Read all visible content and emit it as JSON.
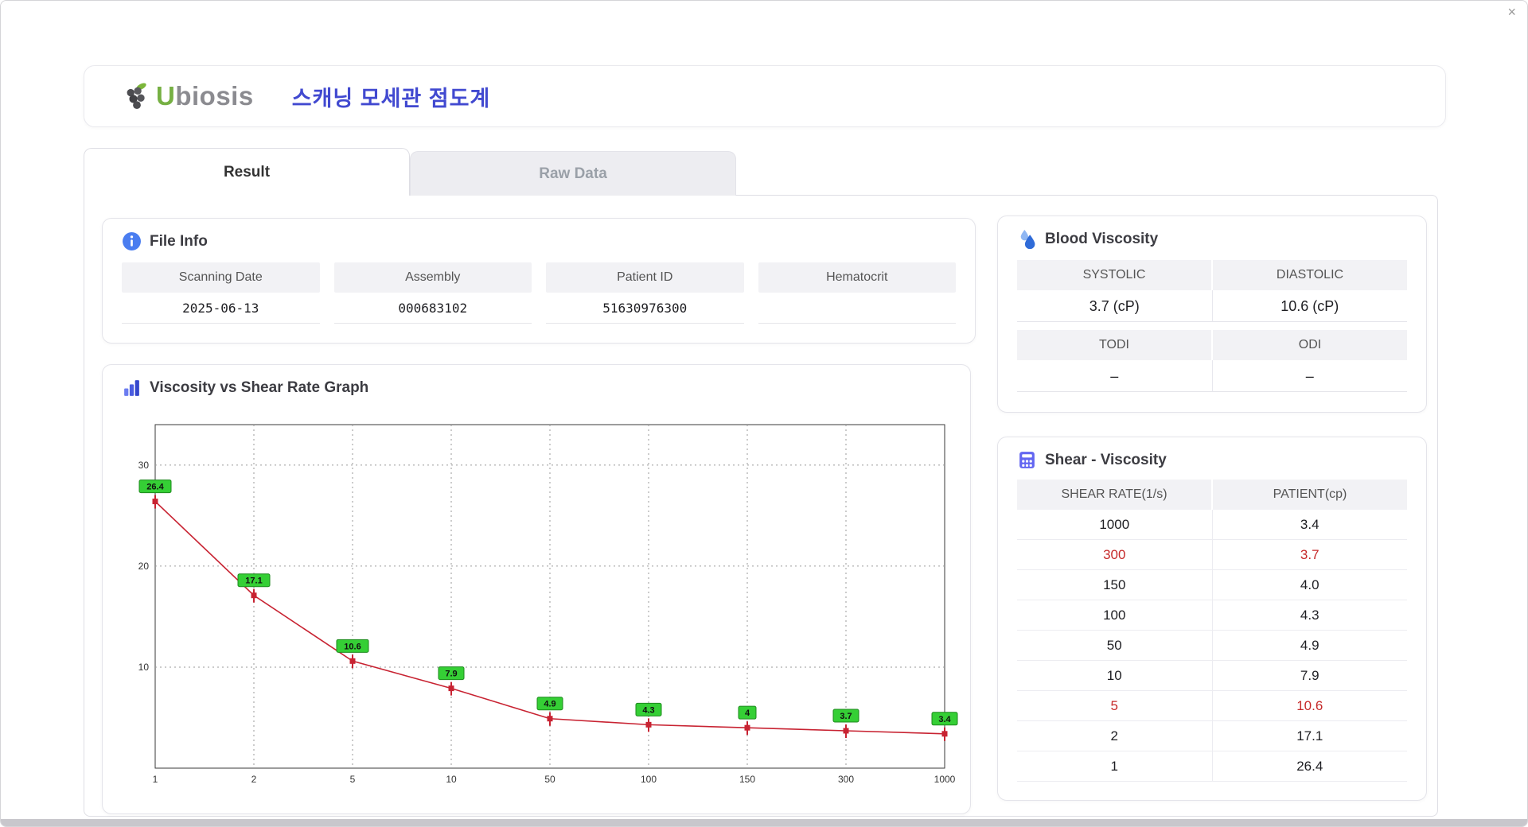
{
  "window": {
    "close_glyph": "×"
  },
  "header": {
    "logo": {
      "u": "U",
      "rest": "biosis"
    },
    "title": "스캐닝 모세관 점도계"
  },
  "tabs": [
    {
      "label": "Result",
      "active": true
    },
    {
      "label": "Raw Data",
      "active": false
    }
  ],
  "file_info": {
    "title": "File Info",
    "fields": [
      {
        "label": "Scanning Date",
        "value": "2025-06-13"
      },
      {
        "label": "Assembly",
        "value": "000683102"
      },
      {
        "label": "Patient ID",
        "value": "51630976300"
      },
      {
        "label": "Hematocrit",
        "value": ""
      }
    ]
  },
  "graph": {
    "title": "Viscosity vs Shear Rate Graph"
  },
  "blood_viscosity": {
    "title": "Blood Viscosity",
    "sections": [
      {
        "headers": [
          "SYSTOLIC",
          "DIASTOLIC"
        ],
        "values": [
          "3.7 (cP)",
          "10.6 (cP)"
        ]
      },
      {
        "headers": [
          "TODI",
          "ODI"
        ],
        "values": [
          "–",
          "–"
        ]
      }
    ]
  },
  "shear_viscosity": {
    "title": "Shear - Viscosity",
    "columns": [
      "SHEAR RATE(1/s)",
      "PATIENT(cp)"
    ],
    "rows": [
      {
        "shear": "1000",
        "patient": "3.4",
        "highlight": false
      },
      {
        "shear": "300",
        "patient": "3.7",
        "highlight": true
      },
      {
        "shear": "150",
        "patient": "4.0",
        "highlight": false
      },
      {
        "shear": "100",
        "patient": "4.3",
        "highlight": false
      },
      {
        "shear": "50",
        "patient": "4.9",
        "highlight": false
      },
      {
        "shear": "10",
        "patient": "7.9",
        "highlight": false
      },
      {
        "shear": "5",
        "patient": "10.6",
        "highlight": true
      },
      {
        "shear": "2",
        "patient": "17.1",
        "highlight": false
      },
      {
        "shear": "1",
        "patient": "26.4",
        "highlight": false
      }
    ]
  },
  "chart_data": {
    "type": "line",
    "title": "Viscosity vs Shear Rate Graph",
    "x": [
      1,
      2,
      5,
      10,
      50,
      100,
      150,
      300,
      1000
    ],
    "x_labels": [
      "1",
      "2",
      "5",
      "10",
      "50",
      "100",
      "150",
      "300",
      "1000"
    ],
    "values": [
      26.4,
      17.1,
      10.6,
      7.9,
      4.9,
      4.3,
      4.0,
      3.7,
      3.4
    ],
    "point_labels": [
      "26.4",
      "17.1",
      "10.6",
      "7.9",
      "4.9",
      "4.3",
      "4",
      "3.7",
      "3.4"
    ],
    "y_ticks": [
      10,
      20,
      30
    ],
    "ylim": [
      0,
      34
    ],
    "grid": "dashed",
    "legend": "none",
    "line_color": "#c82332",
    "marker_color": "#c82332",
    "label_bg": "#35cf35",
    "label_border": "#1d8a1d"
  },
  "colors": {
    "title_blue": "#4149d0",
    "accent_blue": "#4a7df0",
    "icon_indigo": "#6366f1",
    "highlight_red": "#c62a2a",
    "header_gray": "#f2f2f5",
    "logo_green": "#76b043"
  }
}
